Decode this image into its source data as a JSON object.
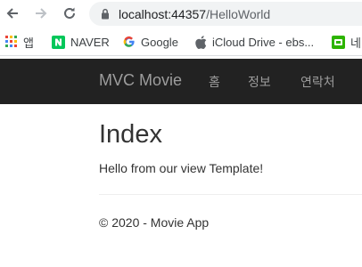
{
  "browser": {
    "url_host": "localhost:44357",
    "url_path": "/HelloWorld"
  },
  "bookmarks": [
    {
      "label": "앱",
      "icon": "apps-grid-icon"
    },
    {
      "label": "NAVER",
      "icon": "naver-icon"
    },
    {
      "label": "Google",
      "icon": "google-icon"
    },
    {
      "label": "iCloud Drive - ebs...",
      "icon": "apple-icon"
    },
    {
      "label": "네",
      "icon": "naver-green-icon"
    }
  ],
  "navbar": {
    "brand": "MVC Movie",
    "links": [
      "홈",
      "정보",
      "연락처"
    ]
  },
  "main": {
    "title": "Index",
    "message": "Hello from our view Template!"
  },
  "footer": {
    "text": "© 2020 - Movie App"
  },
  "colors": {
    "navbar_bg": "#222222",
    "navbar_text": "#9d9d9d",
    "naver_green": "#03c75a"
  }
}
